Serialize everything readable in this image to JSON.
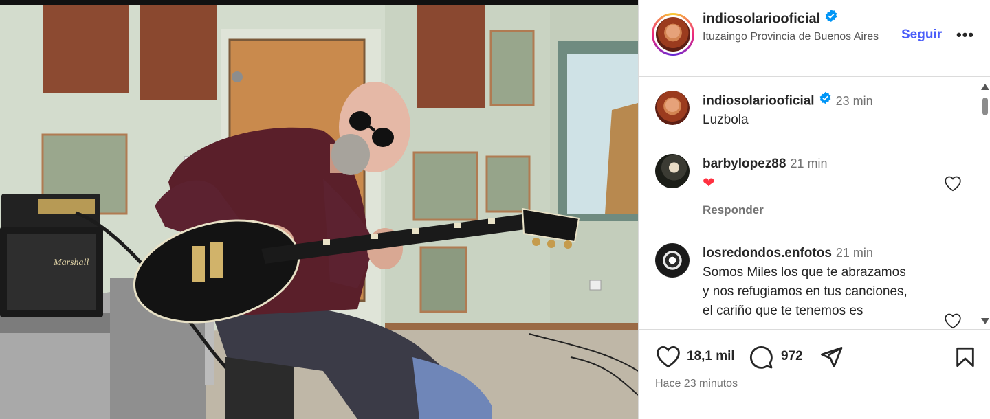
{
  "post": {
    "username": "indiosolariooficial",
    "location": "Ituzaingo Provincia de Buenos Aires",
    "follow_label": "Seguir",
    "more_label": "•••"
  },
  "caption": {
    "username": "indiosolariooficial",
    "time": "23 min",
    "text": "Luzbola"
  },
  "comments": [
    {
      "username": "barbylopez88",
      "time": "21 min",
      "text": "❤",
      "reply_label": "Responder"
    },
    {
      "username": "losredondos.enfotos",
      "time": "21 min",
      "text_lines": [
        "Somos Miles los que te abrazamos",
        "y nos refugiamos en tus canciones,",
        "el cariño que te tenemos es"
      ]
    }
  ],
  "stats": {
    "likes": "18,1 mil",
    "comments": "972",
    "posted": "Hace 23 minutos"
  },
  "icons": {
    "verified": "verified-badge-icon",
    "like": "heart-icon",
    "comment": "comment-bubble-icon",
    "share": "paper-plane-icon",
    "save": "bookmark-icon"
  },
  "colors": {
    "follow": "#4a5df9",
    "verified": "#0095f6",
    "heart": "#ff3040"
  }
}
